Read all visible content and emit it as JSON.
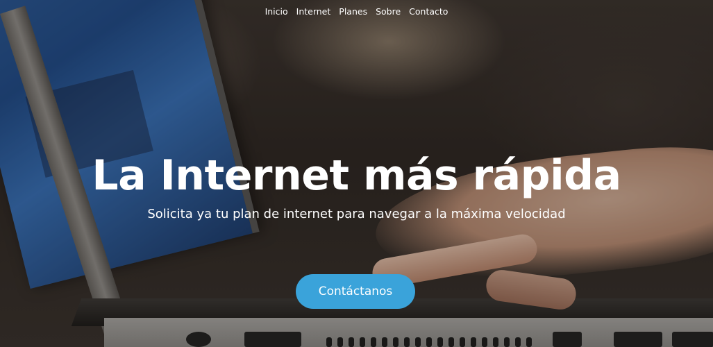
{
  "nav": {
    "items": [
      {
        "label": "Inicio"
      },
      {
        "label": "Internet"
      },
      {
        "label": "Planes"
      },
      {
        "label": "Sobre"
      },
      {
        "label": "Contacto"
      }
    ]
  },
  "hero": {
    "title": "La Internet más rápida",
    "subtitle": "Solicita ya tu plan de internet para navegar a la máxima velocidad",
    "cta_label": "Contáctanos",
    "background_image": "laptop-typing-photo"
  },
  "colors": {
    "cta_background": "#3aa3da",
    "text": "#ffffff"
  }
}
